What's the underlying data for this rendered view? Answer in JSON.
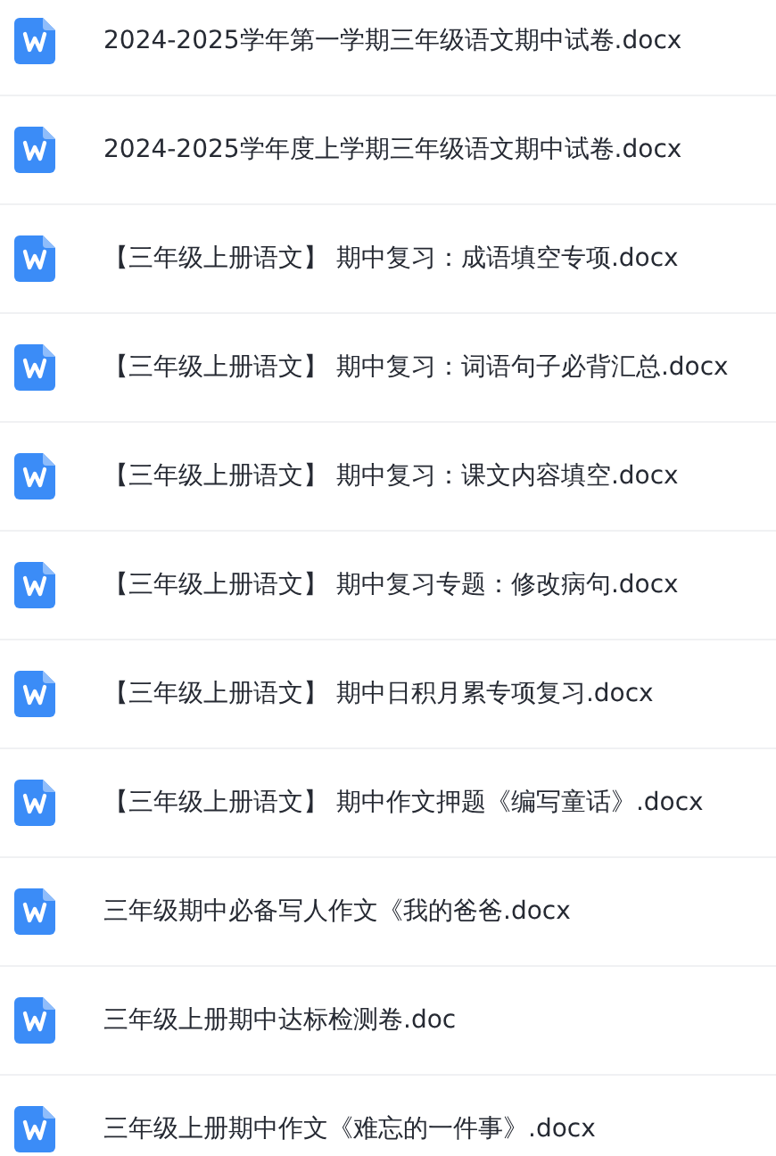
{
  "files": [
    {
      "name": "2024-2025学年第一学期三年级语文期中试卷.docx"
    },
    {
      "name": "2024-2025学年度上学期三年级语文期中试卷.docx"
    },
    {
      "name": "【三年级上册语文】 期中复习：成语填空专项.docx"
    },
    {
      "name": "【三年级上册语文】 期中复习：词语句子必背汇总.docx"
    },
    {
      "name": "【三年级上册语文】 期中复习：课文内容填空.docx"
    },
    {
      "name": "【三年级上册语文】 期中复习专题：修改病句.docx"
    },
    {
      "name": "【三年级上册语文】 期中日积月累专项复习.docx"
    },
    {
      "name": "【三年级上册语文】 期中作文押题《编写童话》.docx"
    },
    {
      "name": "三年级期中必备写人作文《我的爸爸.docx"
    },
    {
      "name": "三年级上册期中达标检测卷.doc"
    },
    {
      "name": "三年级上册期中作文《难忘的一件事》.docx"
    }
  ]
}
